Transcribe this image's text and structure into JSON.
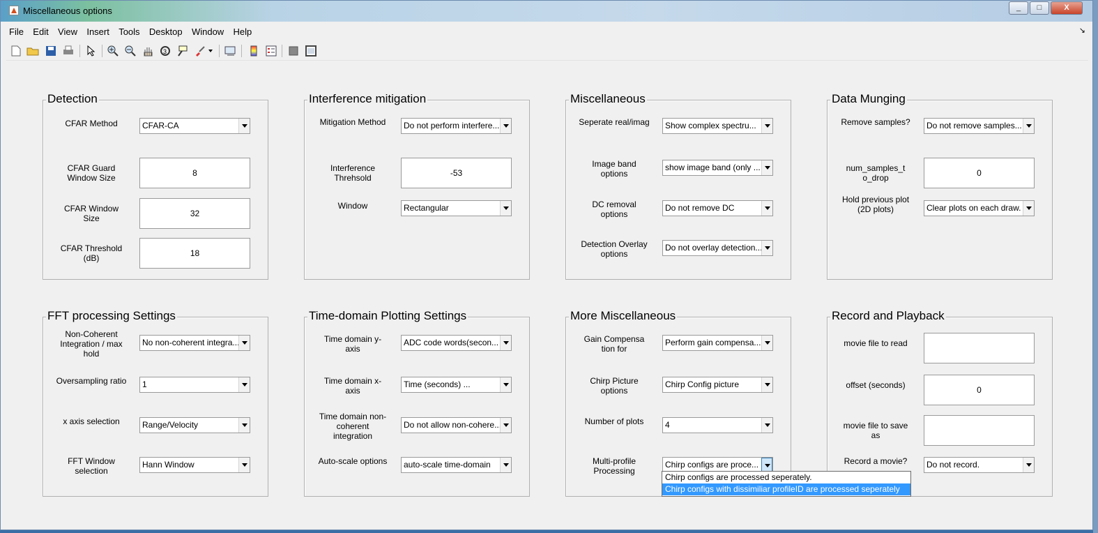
{
  "window": {
    "title": "Miscellaneous options",
    "min": "_",
    "max": "□",
    "close": "X"
  },
  "menu": [
    "File",
    "Edit",
    "View",
    "Insert",
    "Tools",
    "Desktop",
    "Window",
    "Help"
  ],
  "dock_glyph": "↘",
  "toolbar": [
    "new-file-icon",
    "open-folder-icon",
    "save-icon",
    "print-icon",
    "select-arrow-icon",
    "zoom-in-icon",
    "zoom-out-icon",
    "pan-hand-icon",
    "rotate-3d-icon",
    "data-cursor-icon",
    "brush-icon",
    "brush-dropdown-icon",
    "link-plot-icon",
    "colorbar-icon",
    "legend-icon",
    "hide-plot-tools-icon",
    "show-plot-tools-icon"
  ],
  "panels": {
    "detection": {
      "title": "Detection",
      "rows": [
        {
          "label": "CFAR Method",
          "type": "dropdown",
          "value": "CFAR-CA"
        },
        {
          "label": "CFAR Guard Window Size",
          "type": "edit",
          "value": "8"
        },
        {
          "label": "CFAR Window Size",
          "type": "edit",
          "value": "32"
        },
        {
          "label": "CFAR Threshold (dB)",
          "type": "edit",
          "value": "18"
        }
      ]
    },
    "interference": {
      "title": "Interference mitigation",
      "rows": [
        {
          "label": "Mitigation Method",
          "type": "dropdown",
          "value": "Do not perform interfere..."
        },
        {
          "label": "Interference Threhsold",
          "type": "edit",
          "value": "-53"
        },
        {
          "label": "Window",
          "type": "dropdown",
          "value": "Rectangular"
        }
      ]
    },
    "misc": {
      "title": "Miscellaneous",
      "rows": [
        {
          "label": "Seperate real/imag",
          "type": "dropdown",
          "value": "Show complex spectru..."
        },
        {
          "label": "Image band options",
          "type": "dropdown",
          "value": "show image band (only ..."
        },
        {
          "label": "DC removal options",
          "type": "dropdown",
          "value": "Do not remove DC"
        },
        {
          "label": "Detection Overlay options",
          "type": "dropdown",
          "value": "Do not overlay detection..."
        }
      ]
    },
    "munging": {
      "title": "Data Munging",
      "rows": [
        {
          "label": "Remove samples?",
          "type": "dropdown",
          "value": "Do not remove samples..."
        },
        {
          "label": "num_samples_t o_drop",
          "type": "edit",
          "value": "0"
        },
        {
          "label": "Hold previous plot (2D plots)",
          "type": "dropdown",
          "value": "Clear plots on each draw."
        }
      ]
    },
    "fft": {
      "title": "FFT processing Settings",
      "rows": [
        {
          "label": "Non-Coherent Integration / max hold",
          "type": "dropdown",
          "value": "No non-coherent integra..."
        },
        {
          "label": "Oversampling ratio",
          "type": "dropdown",
          "value": "1"
        },
        {
          "label": "x axis selection",
          "type": "dropdown",
          "value": "Range/Velocity"
        },
        {
          "label": "FFT Window selection",
          "type": "dropdown",
          "value": "Hann Window"
        }
      ]
    },
    "timedomain": {
      "title": "Time-domain Plotting Settings",
      "rows": [
        {
          "label": "Time domain y-axis",
          "type": "dropdown",
          "value": "ADC code words(secon..."
        },
        {
          "label": "Time domain x-axis",
          "type": "dropdown",
          "value": "Time (seconds)          ..."
        },
        {
          "label": "Time domain non-coherent integration",
          "type": "dropdown",
          "value": "Do not allow non-cohere..."
        },
        {
          "label": "Auto-scale options",
          "type": "dropdown",
          "value": "auto-scale time-domain"
        }
      ]
    },
    "moremisc": {
      "title": "More Miscellaneous",
      "rows": [
        {
          "label": "Gain Compensa tion for",
          "type": "dropdown",
          "value": "Perform gain compensa..."
        },
        {
          "label": "Chirp Picture options",
          "type": "dropdown",
          "value": "Chirp Config picture"
        },
        {
          "label": "Number of plots",
          "type": "dropdown",
          "value": "4"
        },
        {
          "label": "Multi-profile Processing",
          "type": "dropdown",
          "value": "Chirp configs are proce..."
        }
      ]
    },
    "record": {
      "title": "Record and Playback",
      "rows": [
        {
          "label": "movie file to read",
          "type": "edit",
          "value": ""
        },
        {
          "label": "offset (seconds)",
          "type": "edit",
          "value": "0"
        },
        {
          "label": "movie file to save as",
          "type": "edit",
          "value": ""
        },
        {
          "label": "Record a movie?",
          "type": "dropdown",
          "value": "Do not record."
        }
      ]
    }
  },
  "popup": {
    "options": [
      "Chirp configs are processed seperately.",
      "Chirp configs with dissimiliar profileID are processed seperately"
    ],
    "selected": 1
  },
  "colors": {
    "accent": "#3399ff",
    "panel_bg": "#f0f0f0"
  }
}
